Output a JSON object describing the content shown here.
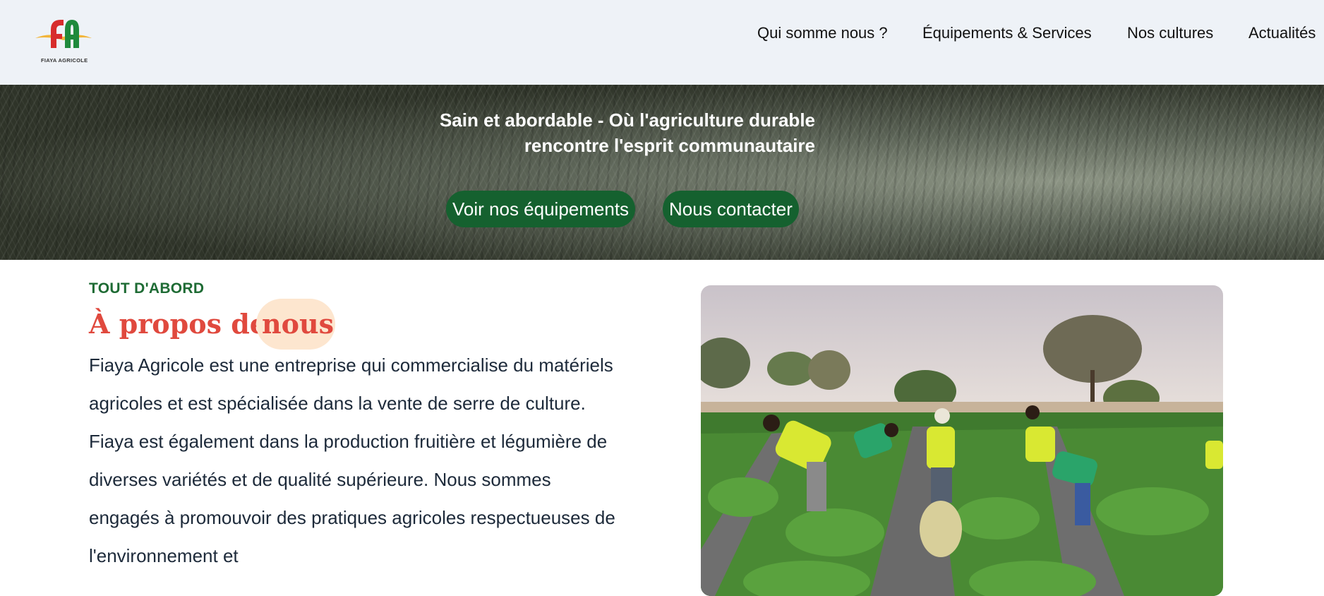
{
  "header": {
    "logo_text": "FIAYA AGRICOLE",
    "nav": [
      {
        "label": "Qui somme nous ?"
      },
      {
        "label": "Équipements & Services"
      },
      {
        "label": "Nos cultures"
      },
      {
        "label": "Actualités"
      }
    ]
  },
  "hero": {
    "title_line1": "Sain et abordable - Où l'agriculture durable",
    "title_line2": "rencontre l'esprit communautaire",
    "btn_equipment": "Voir nos équipements",
    "btn_contact": "Nous contacter"
  },
  "about": {
    "eyebrow": "TOUT D'ABORD",
    "title_part1": "À propos de",
    "title_highlight": "nous",
    "text": "Fiaya Agricole est une entreprise qui commercialise du matériels agricoles et est spécialisée dans la vente de serre de culture. Fiaya est également dans la production fruitière et légumière de diverses variétés et de qualité supérieure. Nous sommes engagés à promouvoir des pratiques agricoles respectueuses de l'environnement et"
  },
  "colors": {
    "primary_green": "#15612f",
    "accent_red": "#e0493e",
    "highlight": "#fde6cf",
    "header_bg": "#eef2f7"
  }
}
